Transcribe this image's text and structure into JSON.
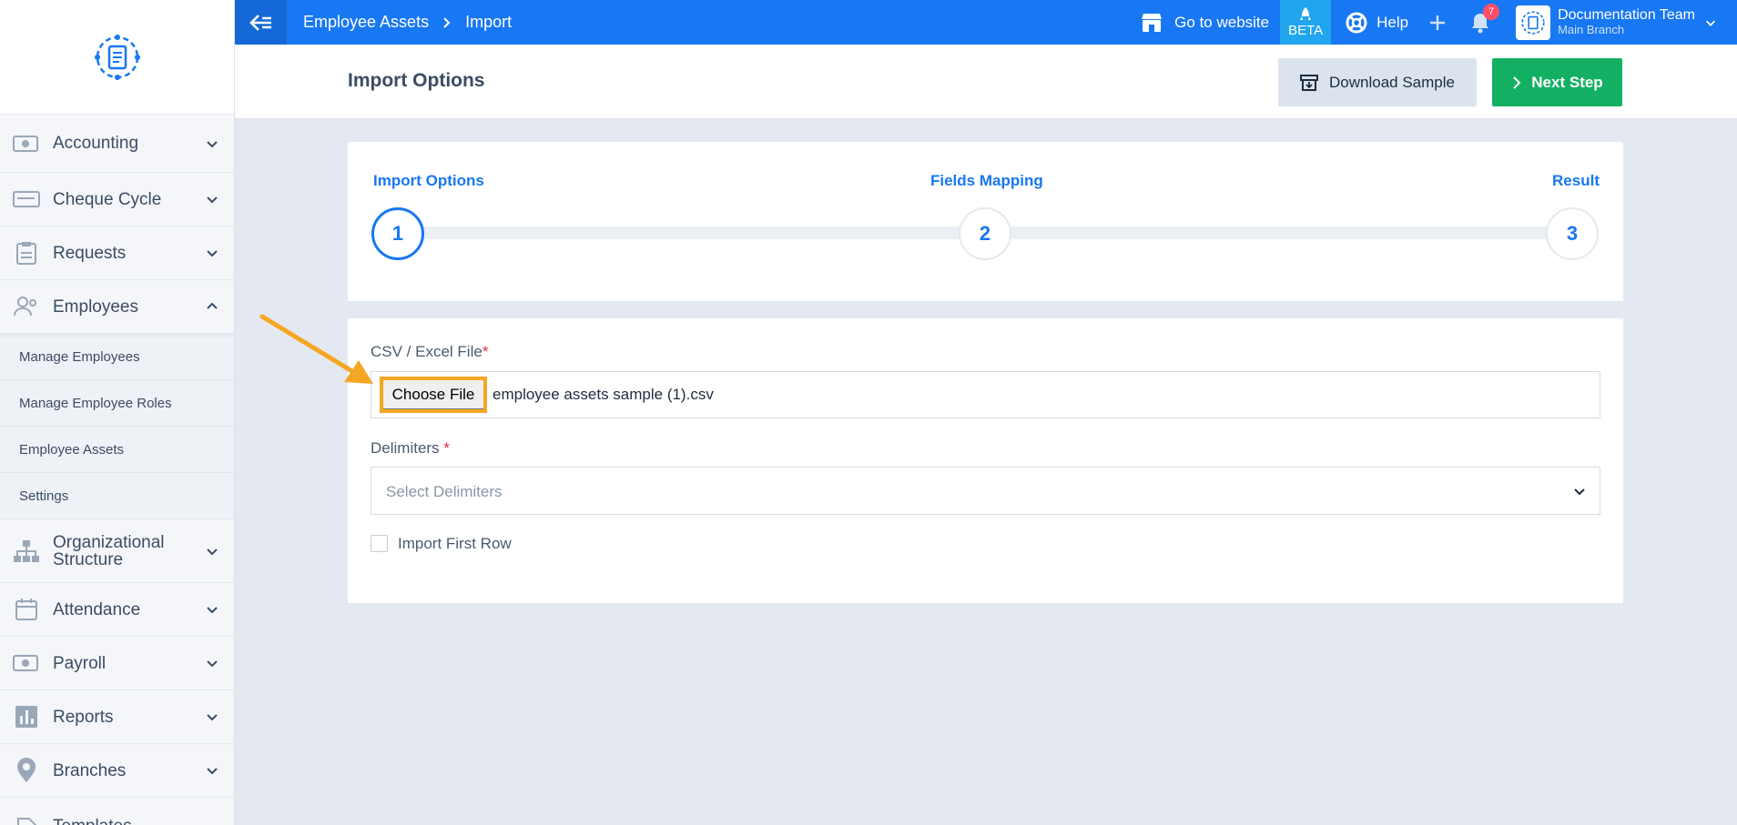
{
  "sidebar": {
    "items": [
      {
        "label": "Accounting",
        "icon": "money-icon"
      },
      {
        "label": "Cheque Cycle",
        "icon": "cheque-icon"
      },
      {
        "label": "Requests",
        "icon": "clipboard-icon"
      },
      {
        "label": "Employees",
        "icon": "users-icon"
      },
      {
        "label": "Organizational Structure",
        "icon": "org-chart-icon"
      },
      {
        "label": "Attendance",
        "icon": "calendar-icon"
      },
      {
        "label": "Payroll",
        "icon": "money-icon"
      },
      {
        "label": "Reports",
        "icon": "bar-chart-icon"
      },
      {
        "label": "Branches",
        "icon": "location-pin-icon"
      },
      {
        "label": "Templates",
        "icon": "document-icon"
      }
    ],
    "employees_sub": [
      "Manage Employees",
      "Manage Employee Roles",
      "Employee Assets",
      "Settings"
    ]
  },
  "topbar": {
    "breadcrumb": [
      "Employee Assets",
      "Import"
    ],
    "go_to_website": "Go to website",
    "beta": "BETA",
    "help": "Help",
    "notifications_count": "7",
    "account_name": "Documentation Team",
    "account_branch": "Main Branch"
  },
  "page": {
    "title": "Import Options",
    "download_sample": "Download Sample",
    "next_step": "Next Step"
  },
  "stepper": {
    "steps": [
      {
        "label": "Import Options",
        "number": "1"
      },
      {
        "label": "Fields Mapping",
        "number": "2"
      },
      {
        "label": "Result",
        "number": "3"
      }
    ]
  },
  "form": {
    "file_label": "CSV / Excel File",
    "choose_file": "Choose File",
    "file_name": "employee assets sample (1).csv",
    "delimiters_label": "Delimiters",
    "delimiters_placeholder": "Select Delimiters",
    "import_first_row": "Import First Row",
    "required_mark": "*"
  },
  "colors": {
    "primary": "#1877f2",
    "success": "#13b063",
    "highlight": "#f5a623"
  }
}
